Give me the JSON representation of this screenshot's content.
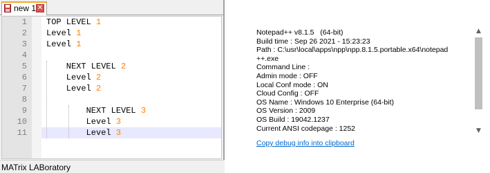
{
  "tab": {
    "label": "new 1",
    "close_glyph": "✕",
    "save_icon": "floppy-disk-icon",
    "close_icon": "close-icon"
  },
  "editor": {
    "line_numbers": [
      "1",
      "2",
      "3",
      "4",
      "5",
      "6",
      "7",
      "8",
      "9",
      "10",
      "11"
    ],
    "lines": [
      {
        "text": "TOP LEVEL ",
        "num": "1"
      },
      {
        "text": "Level ",
        "num": "1"
      },
      {
        "text": "Level ",
        "num": "1"
      },
      {
        "text": "",
        "num": ""
      },
      {
        "text": "    NEXT LEVEL ",
        "num": "2"
      },
      {
        "text": "    Level ",
        "num": "2"
      },
      {
        "text": "    Level ",
        "num": "2"
      },
      {
        "text": "",
        "num": ""
      },
      {
        "text": "        NEXT LEVEL ",
        "num": "3"
      },
      {
        "text": "        Level ",
        "num": "3"
      },
      {
        "text": "        Level ",
        "num": "3"
      }
    ],
    "current_line": 11,
    "colors": {
      "number": "#ff8000",
      "current_line_bg": "#e8e8ff",
      "tab_accent": "#f5a623"
    }
  },
  "status_bar": {
    "text": "MATrix LABoratory"
  },
  "debug_info": {
    "lines": [
      "Notepad++ v8.1.5   (64-bit)",
      "Build time : Sep 26 2021 - 15:23:23",
      "Path : C:\\usr\\local\\apps\\npp\\npp.8.1.5.portable.x64\\notepad",
      "++.exe",
      "Command Line :",
      "Admin mode : OFF",
      "Local Conf mode : ON",
      "Cloud Config : OFF",
      "OS Name : Windows 10 Enterprise (64-bit)",
      "OS Version : 2009",
      "OS Build : 19042.1237",
      "Current ANSI codepage : 1252"
    ],
    "copy_link": "Copy debug info into clipboard",
    "scroll_up_glyph": "▲",
    "scroll_down_glyph": "▼"
  }
}
